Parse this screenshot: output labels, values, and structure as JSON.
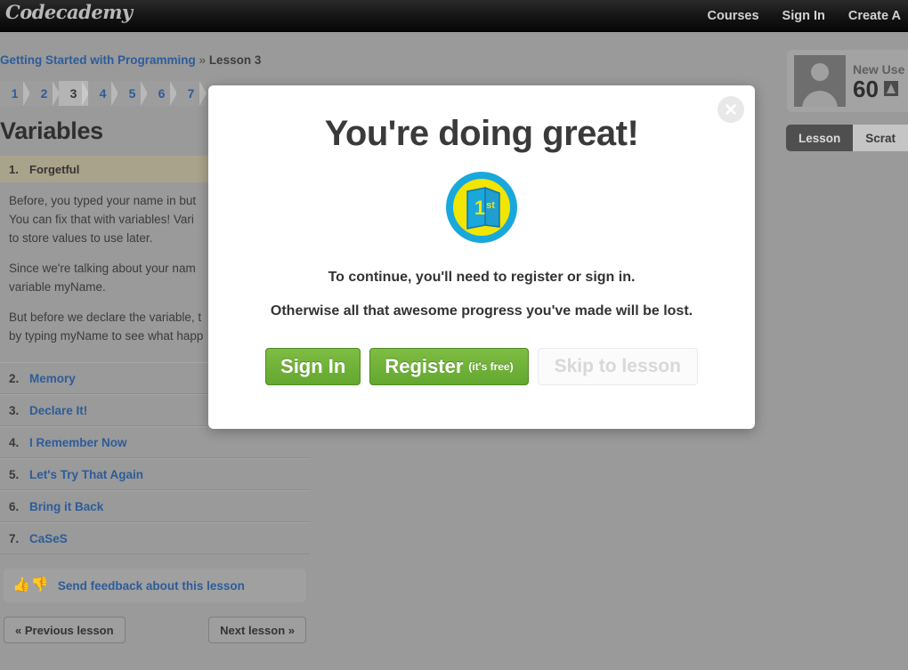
{
  "topnav": {
    "logo": "Codecademy",
    "links": [
      "Courses",
      "Sign In",
      "Create A"
    ]
  },
  "breadcrumb": {
    "course": "Getting Started with Programming",
    "separator": "»",
    "lesson": "Lesson 3"
  },
  "steps": {
    "items": [
      "1",
      "2",
      "3",
      "4",
      "5",
      "6",
      "7"
    ],
    "active": "3"
  },
  "sidebar": {
    "lesson_title": "Variables",
    "current_exercise": {
      "num": "1.",
      "label": "Forgetful"
    },
    "paragraphs": [
      "Before, you typed your name in but",
      "You can fix that with variables! Vari",
      "to store values to use later.",
      "Since we're talking about your nam",
      "variable myName.",
      "But before we declare the variable, t",
      "by typing myName to see what happ"
    ],
    "exercises": [
      {
        "num": "2.",
        "label": "Memory"
      },
      {
        "num": "3.",
        "label": "Declare It!"
      },
      {
        "num": "4.",
        "label": "I Remember Now"
      },
      {
        "num": "5.",
        "label": "Let's Try That Again"
      },
      {
        "num": "6.",
        "label": "Bring it Back"
      },
      {
        "num": "7.",
        "label": "CaSeS"
      }
    ],
    "feedback_label": "Send feedback about this lesson",
    "prev_label": "« Previous lesson",
    "next_label": "Next lesson »"
  },
  "userpanel": {
    "username": "New Use",
    "points": "60"
  },
  "tabs": {
    "items": [
      {
        "label": "Lesson",
        "active": true
      },
      {
        "label": "Scrat",
        "active": false
      }
    ]
  },
  "modal": {
    "title": "You're doing great!",
    "badge_label": "1st",
    "line1": "To continue, you'll need to register or sign in.",
    "line2": "Otherwise all that awesome progress you've made will be lost.",
    "buttons": {
      "signin": "Sign In",
      "register": "Register",
      "register_note": "(it's free)",
      "skip": "Skip to lesson"
    }
  },
  "colors": {
    "overlay": "#979797",
    "green": "#6eb33b",
    "link_blue": "#2d5c99",
    "khaki": "#aaa38b",
    "badge_yellow": "#f2e500",
    "badge_cyan": "#18a8dc"
  }
}
